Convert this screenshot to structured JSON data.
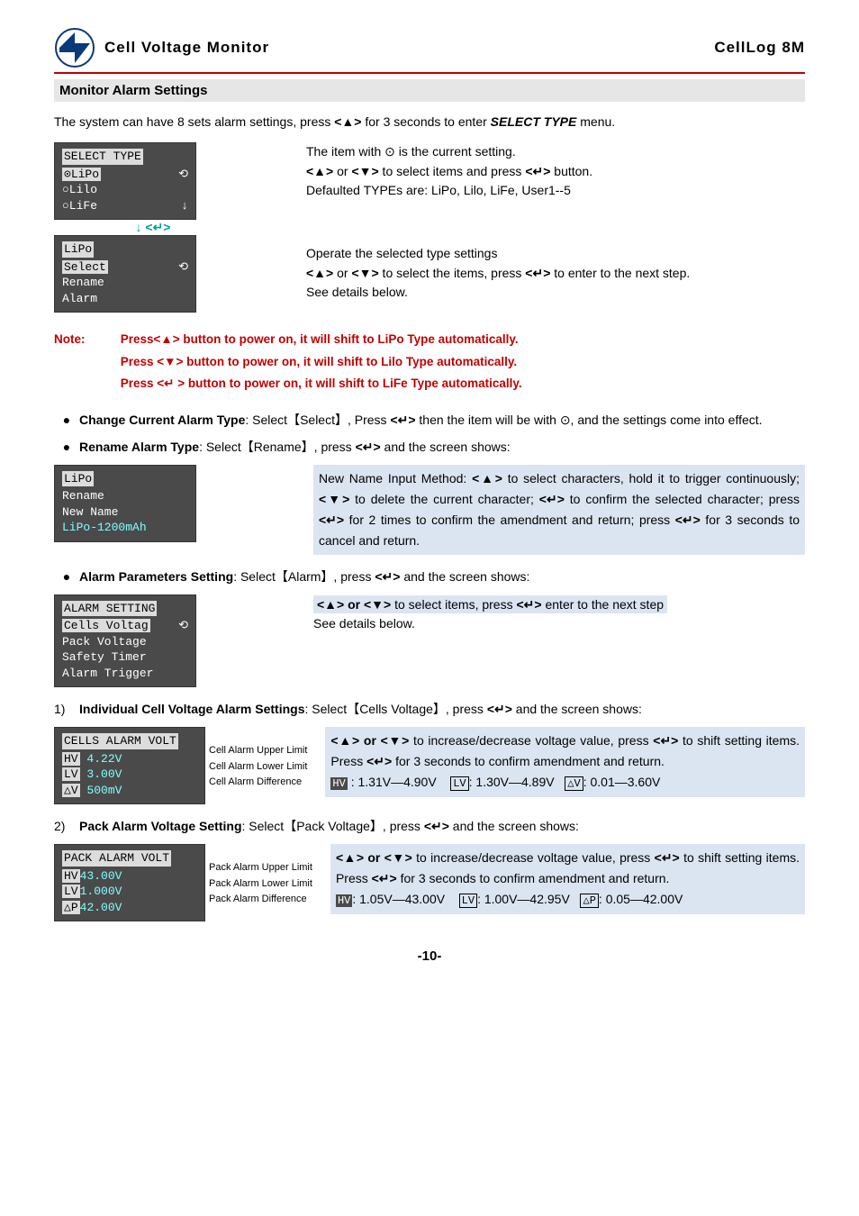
{
  "header": {
    "title_left": "Cell  Voltage  Monitor",
    "title_right": "CellLog  8M"
  },
  "section_title": "Monitor Alarm Settings",
  "intro_pre": "The system can have 8 sets alarm settings, press ",
  "intro_mid": " for 3 seconds to enter ",
  "intro_end": " menu.",
  "select_type_menu": "SELECT TYPE",
  "bold_select_type": "SELECT TYPE",
  "key_up": "<▲>",
  "key_down": "<▼>",
  "key_enter": "<↵>",
  "lcd1": {
    "l1": "⊙LiPo",
    "l2": "○Lilo",
    "l3": "○LiFe"
  },
  "enter_marker": "<↵>",
  "lcd2": {
    "t": "LiPo",
    "l1": "Select",
    "l2": "Rename",
    "l3": "Alarm"
  },
  "desc1a": "The item with ⊙ is the current setting.",
  "desc1b_pre": " or ",
  "desc1b_mid": " to select items and press ",
  "desc1b_end": " button.",
  "desc1c": "Defaulted TYPEs are: LiPo, Lilo, LiFe, User1--5",
  "desc2a": "Operate the selected type settings",
  "desc2b_pre": " or ",
  "desc2b_mid": " to select the items, press ",
  "desc2b_end": " to enter to the next step.",
  "desc2c": "See details below.",
  "note_label": "Note:",
  "note1": "Press<▲> button to power on, it will shift to LiPo Type automatically.",
  "note2": "Press <▼> button to power on, it will shift to Lilo Type automatically.",
  "note3": "Press <↵ > button to power on, it will shift to LiFe Type automatically.",
  "bullet1_pre": "Change Current Alarm Type",
  "bullet1_mid": ": Select【Select】, Press ",
  "bullet1_end": " then the item will be with ⊙, and the settings come into effect.",
  "bullet2_pre": "Rename Alarm Type",
  "bullet2_mid": ": Select【Rename】, press ",
  "bullet2_end": " and the screen shows:",
  "lcd_rename": {
    "t": "LiPo",
    "l1": "Rename",
    "l2": "New Name",
    "l3": "LiPo-1200mAh"
  },
  "rename_desc_1": "New Name Input Method: ",
  "rename_desc_2": " to select characters, hold it to trigger continuously; ",
  "rename_desc_3": " to delete the current character; ",
  "rename_desc_4": " to confirm the selected character; press ",
  "rename_desc_5": " for 2 times to confirm the amendment and return; press ",
  "rename_desc_6": " for 3 seconds to cancel and return.",
  "bullet3_pre": "Alarm Parameters Setting",
  "bullet3_mid": ": Select【Alarm】, press ",
  "bullet3_end": " and the screen shows:",
  "lcd_alarm": {
    "t": "ALARM SETTING",
    "l1": "Cells Voltag",
    "l2": "Pack Voltage",
    "l3": "Safety Timer",
    "l4": "Alarm Trigger"
  },
  "alarm_desc_pre": " to select items, press ",
  "alarm_desc_mid": " enter to the next step",
  "alarm_desc_end": "See details below.",
  "num1_pre": "Individual Cell Voltage Alarm Settings",
  "num1_mid": ": Select【Cells Voltage】, press ",
  "num1_end": " and the screen shows:",
  "n1": "1)",
  "lcd_cells": {
    "t": "CELLS ALARM VOLT",
    "l1a": "HV",
    "l1b": " 4.22V",
    "l2a": "LV",
    "l2b": " 3.00V",
    "l3a": "△V",
    "l3b": " 500mV"
  },
  "callouts1": {
    "a": "Cell Alarm Upper Limit",
    "b": "Cell Alarm Lower Limit",
    "c": "Cell Alarm Difference"
  },
  "shade1_pre": " or ",
  "shade1_a": " to increase/decrease voltage value, press ",
  "shade1_b": " to shift setting items. Press ",
  "shade1_c": " for 3 seconds to confirm amendment and return.",
  "ranges1_hv": " : 1.31V—4.90V",
  "ranges1_lv": ": 1.30V—4.89V",
  "ranges1_dv": ": 0.01—3.60V",
  "lbl_hv": "HV",
  "lbl_lv": "LV",
  "lbl_dv": "△V",
  "lbl_dp": "△P",
  "num2_pre": "Pack Alarm Voltage Setting",
  "num2_mid": ": Select【Pack Voltage】, press ",
  "num2_end": " and the screen shows:",
  "n2": "2)",
  "lcd_pack": {
    "t": "PACK ALARM VOLT",
    "l1a": "HV",
    "l1b": "43.00V",
    "l2a": "LV",
    "l2b": "1.000V",
    "l3a": "△P",
    "l3b": "42.00V"
  },
  "callouts2": {
    "a": "Pack Alarm Upper Limit",
    "b": "Pack Alarm Lower Limit",
    "c": "Pack Alarm Difference"
  },
  "ranges2_hv": ": 1.05V—43.00V",
  "ranges2_lv": ": 1.00V—42.95V",
  "ranges2_dp": ": 0.05—42.00V",
  "page_number": "-10-",
  "b_or": " or "
}
